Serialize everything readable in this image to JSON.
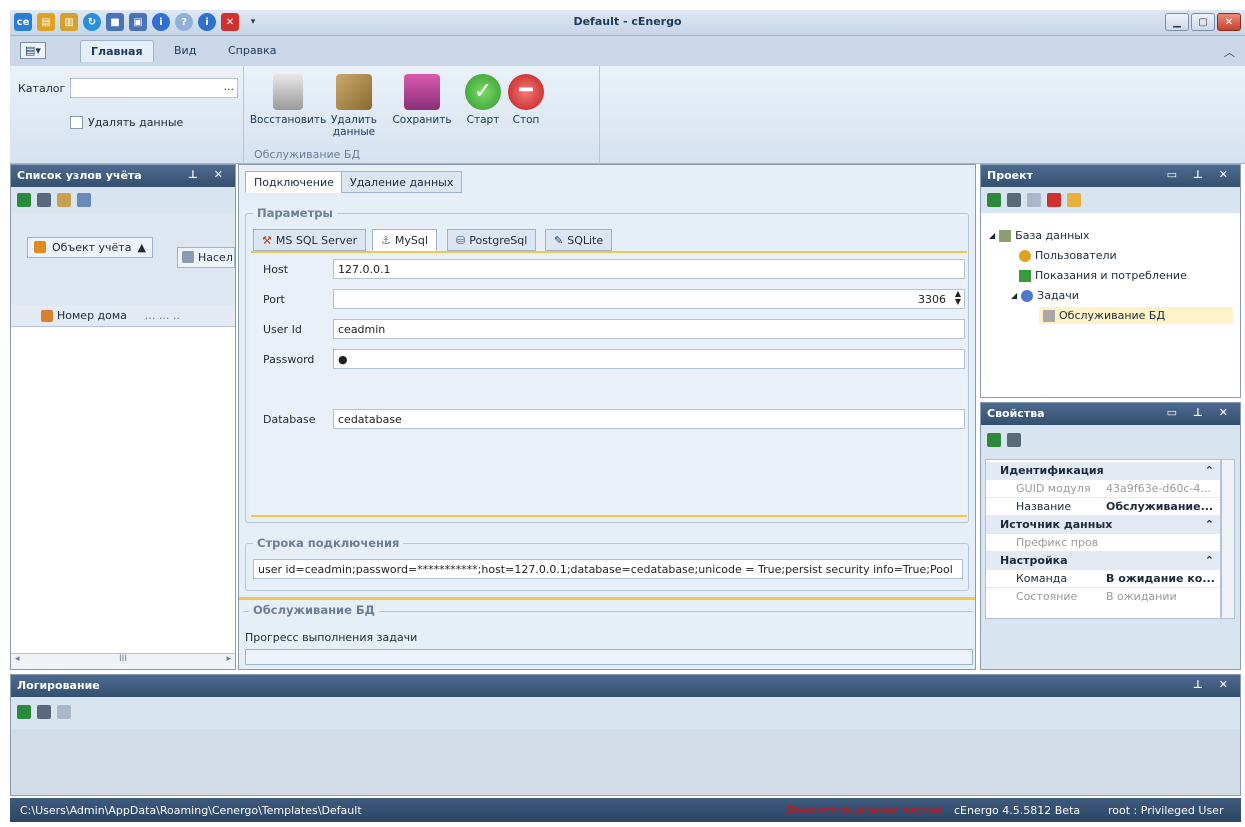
{
  "window": {
    "title": "Default - cEnergo"
  },
  "ribbon_tabs": [
    "Главная",
    "Вид",
    "Справка"
  ],
  "ribbon": {
    "catalog_label": "Каталог",
    "catalog_value": "",
    "catalog_browse": "...",
    "delete_data_checkbox": "Удалять данные",
    "buttons": {
      "restore": "Восстановить",
      "delete_line1": "Удалить",
      "delete_line2": "данные",
      "save": "Сохранить",
      "start": "Старт",
      "stop": "Стоп"
    },
    "group_label": "Обслуживание БД"
  },
  "left_panel": {
    "title": "Список узлов учёта",
    "group_chip": "Объект учёта",
    "group_chip2": "Насел",
    "column_header": "Номер дома",
    "column_extra": "... ... ..",
    "scroll_grip": "III"
  },
  "center": {
    "tabs": [
      "Подключение",
      "Удаление данных"
    ],
    "params_legend": "Параметры",
    "provider_tabs": [
      "MS SQL Server",
      "MySql",
      "PostgreSql",
      "SQLite"
    ],
    "fields": {
      "host_label": "Host",
      "host_value": "127.0.0.1",
      "port_label": "Port",
      "port_value": "3306",
      "userid_label": "User Id",
      "userid_value": "ceadmin",
      "password_label": "Password",
      "password_value": "●",
      "database_label": "Database",
      "database_value": "cedatabase"
    },
    "connstr_legend": "Строка подключения",
    "connstr_value": "user id=ceadmin;password=***********;host=127.0.0.1;database=cedatabase;unicode = True;persist security info=True;Pool",
    "maint_legend": "Обслуживание БД",
    "progress_label": "Прогресс выполнения задачи",
    "progress": 0
  },
  "project": {
    "title": "Проект",
    "tree": [
      "База данных",
      "Пользователи",
      "Показания и потребление",
      "Задачи",
      "Обслуживание БД"
    ]
  },
  "properties": {
    "title": "Свойства",
    "groups": [
      {
        "name": "Идентификация",
        "rows": [
          [
            "GUID модуля",
            "43a9f63e-d60c-4..."
          ],
          [
            "Название",
            "Обслуживание..."
          ]
        ]
      },
      {
        "name": "Источник данных",
        "rows": [
          [
            "Префикс пров",
            ""
          ]
        ]
      },
      {
        "name": "Настройка",
        "rows": [
          [
            "Команда",
            "В ожидание ко..."
          ],
          [
            "Состояние",
            "В ожидании"
          ]
        ]
      }
    ]
  },
  "log": {
    "title": "Логирование"
  },
  "status": {
    "path": "C:\\Users\\Admin\\AppData\\Roaming\\Cenergo\\Templates\\Default",
    "demo": "Демонстрационная версия",
    "version": "cEnergo 4.5.5812 Beta",
    "user": "root : Privileged User"
  },
  "colors": {
    "demo": "#d01010",
    "accent": "#34506f",
    "selected": "#fdf2c8"
  }
}
